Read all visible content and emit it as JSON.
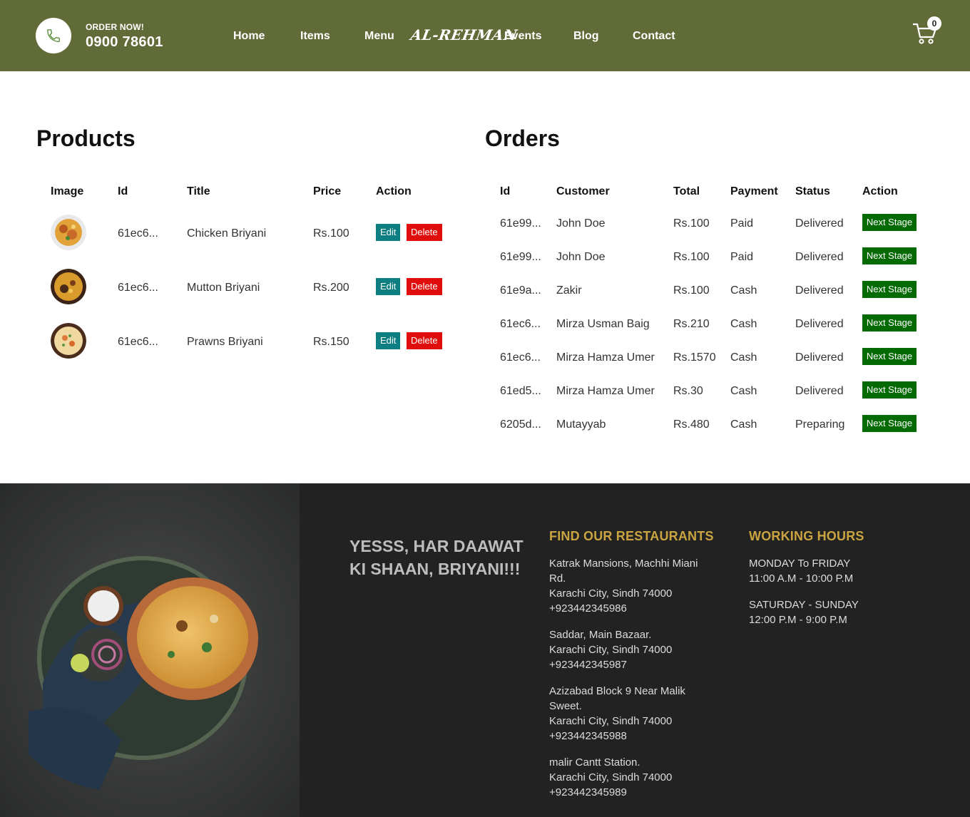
{
  "header": {
    "order_label": "ORDER NOW!",
    "phone": "0900 78601",
    "nav": [
      "Home",
      "Items",
      "Menu",
      "Events",
      "Blog",
      "Contact"
    ],
    "brand": "AL-REHMAN",
    "cart_count": "0",
    "color": "#606b38"
  },
  "products": {
    "title": "Products",
    "columns": [
      "Image",
      "Id",
      "Title",
      "Price",
      "Action"
    ],
    "rows": [
      {
        "id": "61ec6...",
        "title": "Chicken Briyani",
        "price": "Rs.100"
      },
      {
        "id": "61ec6...",
        "title": "Mutton Briyani",
        "price": "Rs.200"
      },
      {
        "id": "61ec6...",
        "title": "Prawns Briyani",
        "price": "Rs.150"
      }
    ],
    "edit_label": "Edit",
    "delete_label": "Delete"
  },
  "orders": {
    "title": "Orders",
    "columns": [
      "Id",
      "Customer",
      "Total",
      "Payment",
      "Status",
      "Action"
    ],
    "rows": [
      {
        "id": "61e99...",
        "customer": "John Doe",
        "total": "Rs.100",
        "payment": "Paid",
        "status": "Delivered"
      },
      {
        "id": "61e99...",
        "customer": "John Doe",
        "total": "Rs.100",
        "payment": "Paid",
        "status": "Delivered"
      },
      {
        "id": "61e9a...",
        "customer": "Zakir",
        "total": "Rs.100",
        "payment": "Cash",
        "status": "Delivered"
      },
      {
        "id": "61ec6...",
        "customer": "Mirza Usman Baig",
        "total": "Rs.210",
        "payment": "Cash",
        "status": "Delivered"
      },
      {
        "id": "61ec6...",
        "customer": "Mirza Hamza Umer",
        "total": "Rs.1570",
        "payment": "Cash",
        "status": "Delivered"
      },
      {
        "id": "61ed5...",
        "customer": "Mirza Hamza Umer",
        "total": "Rs.30",
        "payment": "Cash",
        "status": "Delivered"
      },
      {
        "id": "6205d...",
        "customer": "Mutayyab",
        "total": "Rs.480",
        "payment": "Cash",
        "status": "Preparing"
      }
    ],
    "next_label": "Next Stage"
  },
  "footer": {
    "slogan": "YESSS, HAR DAAWAT KI SHAAN, BRIYANI!!!",
    "restaurants_title": "FIND OUR RESTAURANTS",
    "restaurants": [
      [
        "Katrak Mansions, Machhi Miani",
        "Rd.",
        "Karachi City, Sindh 74000",
        "+923442345986"
      ],
      [
        "Saddar, Main Bazaar.",
        "Karachi City, Sindh 74000",
        "+923442345987"
      ],
      [
        "Azizabad Block 9 Near Malik",
        "Sweet.",
        "Karachi City, Sindh 74000",
        "+923442345988"
      ],
      [
        "malir Cantt Station.",
        "Karachi City, Sindh 74000",
        "+923442345989"
      ]
    ],
    "hours_title": "WORKING HOURS",
    "hours": [
      [
        "MONDAY To FRIDAY",
        "11:00 A.M - 10:00 P.M"
      ],
      [
        "SATURDAY - SUNDAY",
        "12:00 P.M - 9:00 P.M"
      ]
    ],
    "heading_color": "#c9a440"
  }
}
